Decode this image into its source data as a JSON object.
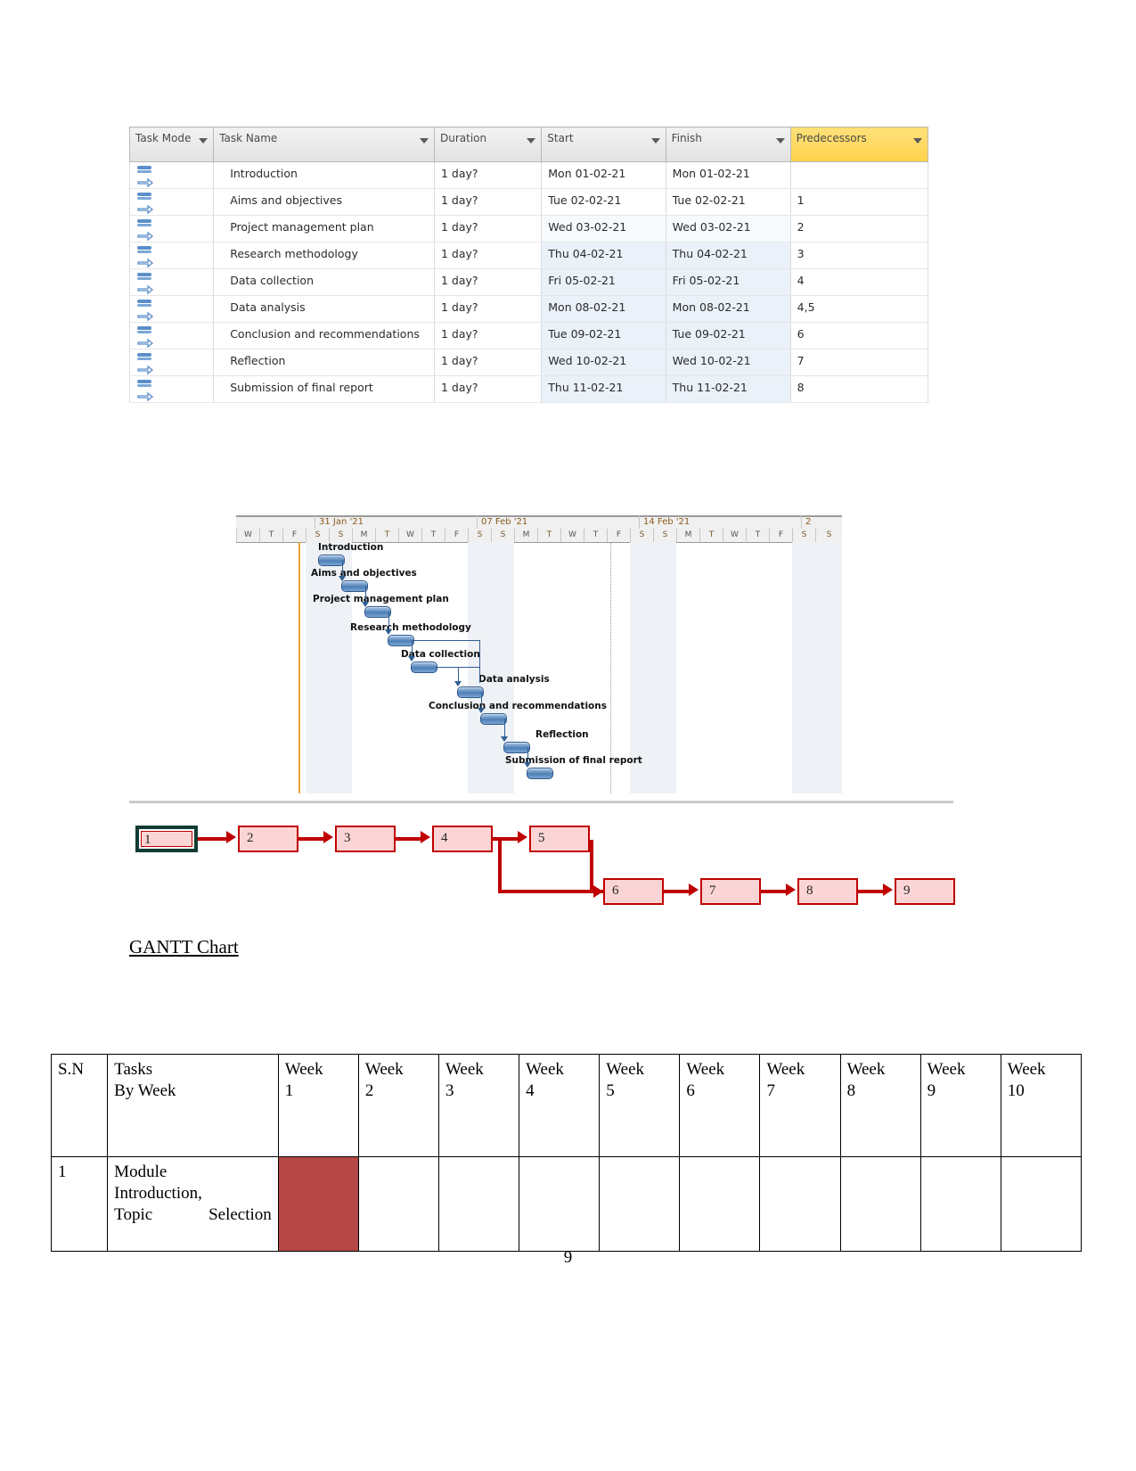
{
  "project_table": {
    "columns": [
      "Task Mode",
      "Task Name",
      "Duration",
      "Start",
      "Finish",
      "Predecessors"
    ],
    "headers": {
      "task_mode": "Task Mode",
      "task_name": "Task Name",
      "duration": "Duration",
      "start": "Start",
      "finish": "Finish",
      "predecessors": "Predecessors"
    },
    "header_highlight_color": "#ffd34d",
    "rows": [
      {
        "name": "Introduction",
        "duration": "1 day?",
        "start": "Mon 01-02-21",
        "finish": "Mon 01-02-21",
        "predecessors": ""
      },
      {
        "name": "Aims and objectives",
        "duration": "1 day?",
        "start": "Tue 02-02-21",
        "finish": "Tue 02-02-21",
        "predecessors": "1"
      },
      {
        "name": "Project management plan",
        "duration": "1 day?",
        "start": "Wed 03-02-21",
        "finish": "Wed 03-02-21",
        "predecessors": "2"
      },
      {
        "name": "Research methodology",
        "duration": "1 day?",
        "start": "Thu 04-02-21",
        "finish": "Thu 04-02-21",
        "predecessors": "3"
      },
      {
        "name": "Data collection",
        "duration": "1 day?",
        "start": "Fri 05-02-21",
        "finish": "Fri 05-02-21",
        "predecessors": "4"
      },
      {
        "name": "Data analysis",
        "duration": "1 day?",
        "start": "Mon 08-02-21",
        "finish": "Mon 08-02-21",
        "predecessors": "4,5"
      },
      {
        "name": "Conclusion and recommendations",
        "duration": "1 day?",
        "start": "Tue 09-02-21",
        "finish": "Tue 09-02-21",
        "predecessors": "6"
      },
      {
        "name": "Reflection",
        "duration": "1 day?",
        "start": "Wed 10-02-21",
        "finish": "Wed 10-02-21",
        "predecessors": "7"
      },
      {
        "name": "Submission of final report",
        "duration": "1 day?",
        "start": "Thu 11-02-21",
        "finish": "Thu 11-02-21",
        "predecessors": "8"
      }
    ]
  },
  "chart_data": {
    "type": "bar",
    "title": "GANTT Chart",
    "xlabel": "",
    "ylabel": "",
    "timeline_weeks": [
      "31 Jan '21",
      "07 Feb '21",
      "14 Feb '21",
      "2"
    ],
    "day_letters": [
      "W",
      "T",
      "F",
      "S",
      "S",
      "M",
      "T",
      "W",
      "T",
      "F",
      "S",
      "S",
      "M",
      "T",
      "W",
      "T",
      "F",
      "S",
      "S",
      "M",
      "T",
      "W",
      "T",
      "F",
      "S",
      "S"
    ],
    "categories": [
      "Introduction",
      "Aims and objectives",
      "Project management plan",
      "Research methodology",
      "Data collection",
      "Data analysis",
      "Conclusion and recommendations",
      "Reflection",
      "Submission of final report"
    ],
    "values": [
      1,
      1,
      1,
      1,
      1,
      1,
      1,
      1,
      1
    ],
    "bars": [
      {
        "label": "Introduction",
        "start": "Mon 01-02-21",
        "finish": "Mon 01-02-21",
        "duration_days": 1
      },
      {
        "label": "Aims and objectives",
        "start": "Tue 02-02-21",
        "finish": "Tue 02-02-21",
        "duration_days": 1
      },
      {
        "label": "Project management plan",
        "start": "Wed 03-02-21",
        "finish": "Wed 03-02-21",
        "duration_days": 1
      },
      {
        "label": "Research methodology",
        "start": "Thu 04-02-21",
        "finish": "Thu 04-02-21",
        "duration_days": 1
      },
      {
        "label": "Data collection",
        "start": "Fri 05-02-21",
        "finish": "Fri 05-02-21",
        "duration_days": 1
      },
      {
        "label": "Data analysis",
        "start": "Mon 08-02-21",
        "finish": "Mon 08-02-21",
        "duration_days": 1
      },
      {
        "label": "Conclusion and recommendations",
        "start": "Tue 09-02-21",
        "finish": "Tue 09-02-21",
        "duration_days": 1
      },
      {
        "label": "Reflection",
        "start": "Wed 10-02-21",
        "finish": "Wed 10-02-21",
        "duration_days": 1
      },
      {
        "label": "Submission of final report",
        "start": "Thu 11-02-21",
        "finish": "Thu 11-02-21",
        "duration_days": 1
      }
    ],
    "bar_color": "#4e7fb5",
    "grid": true,
    "legend": "none"
  },
  "gantt_captions": {
    "c0": "Introduction",
    "c1": "Aims and objectives",
    "c2": "Project management plan",
    "c3": "Research methodology",
    "c4": "Data collection",
    "c5": "Data analysis",
    "c6": "Conclusion and recommendations",
    "c7": "Reflection",
    "c8": "Submission of final report"
  },
  "timeline": {
    "w0": "31 Jan '21",
    "w1": "07 Feb '21",
    "w2": "14 Feb '21",
    "w3": "2"
  },
  "network_diagram": {
    "node_color": "#fbd5d5",
    "border_color": "#c00000",
    "selected_border_color": "#113b33",
    "nodes": [
      {
        "id": "1",
        "label": "1",
        "selected": true
      },
      {
        "id": "2",
        "label": "2",
        "selected": false
      },
      {
        "id": "3",
        "label": "3",
        "selected": false
      },
      {
        "id": "4",
        "label": "4",
        "selected": false
      },
      {
        "id": "5",
        "label": "5",
        "selected": false
      },
      {
        "id": "6",
        "label": "6",
        "selected": false
      },
      {
        "id": "7",
        "label": "7",
        "selected": false
      },
      {
        "id": "8",
        "label": "8",
        "selected": false
      },
      {
        "id": "9",
        "label": "9",
        "selected": false
      }
    ],
    "edges": [
      "1->2",
      "2->3",
      "3->4",
      "4->5",
      "4->6",
      "5->6",
      "6->7",
      "7->8",
      "8->9"
    ]
  },
  "caption": {
    "text": "GANTT Chart"
  },
  "week_table": {
    "headers": {
      "sn": "S.N",
      "tasks": "Tasks\nBy Week",
      "tasks_line1": "Tasks",
      "tasks_line2": "By Week",
      "weeks": [
        {
          "l1": "Week",
          "l2": "1"
        },
        {
          "l1": "Week",
          "l2": "2"
        },
        {
          "l1": "Week",
          "l2": "3"
        },
        {
          "l1": "Week",
          "l2": "4"
        },
        {
          "l1": "Week",
          "l2": "5"
        },
        {
          "l1": "Week",
          "l2": "6"
        },
        {
          "l1": "Week",
          "l2": "7"
        },
        {
          "l1": "Week",
          "l2": "8"
        },
        {
          "l1": "Week",
          "l2": "9"
        },
        {
          "l1": "Week",
          "l2": "10"
        }
      ]
    },
    "rows": [
      {
        "sn": "1",
        "task_line1": "Module",
        "task_line2": "Introduction,",
        "task_line3": "Topic      Selection",
        "filled_weeks": [
          1
        ],
        "fill_color": "#b54747"
      }
    ]
  },
  "page": {
    "number": "9"
  }
}
